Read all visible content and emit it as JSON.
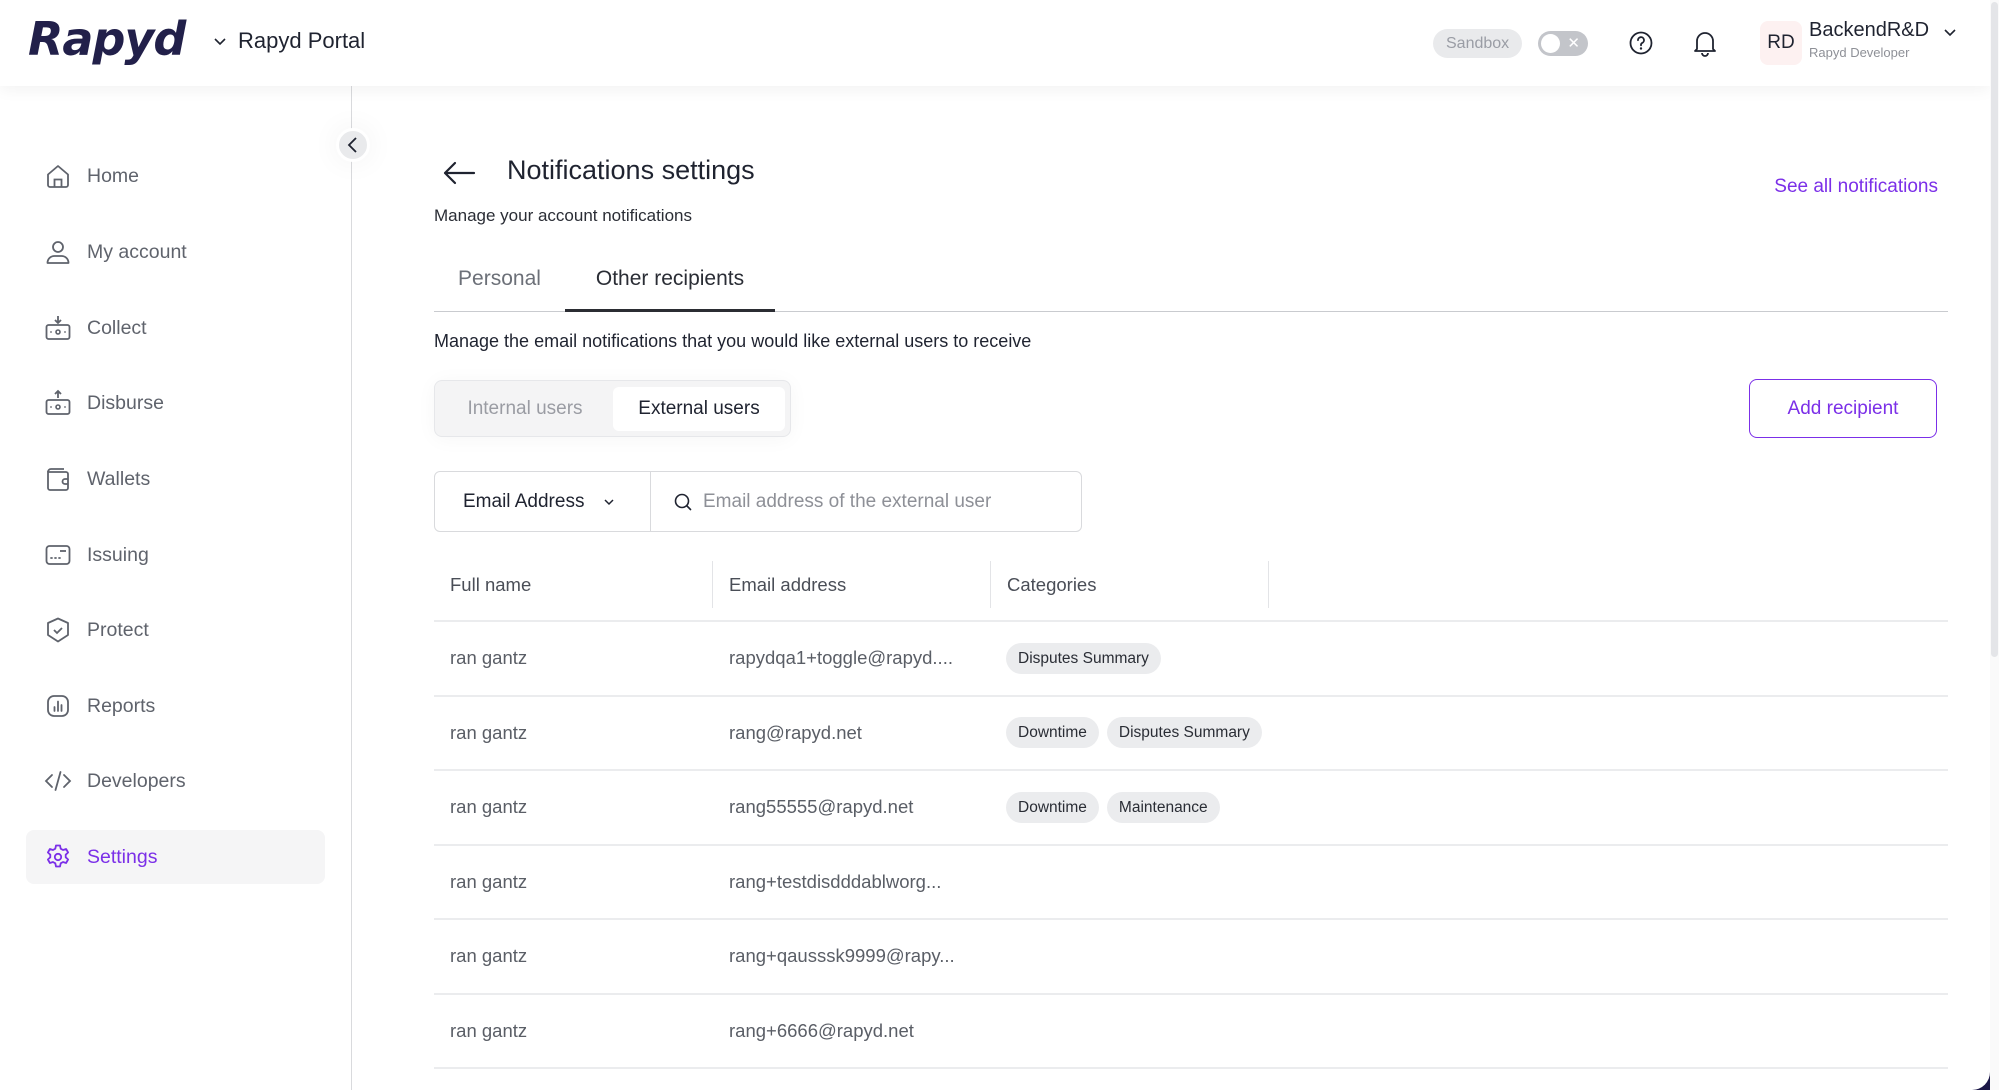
{
  "header": {
    "logo": "Rapyd",
    "portal_label": "Rapyd Portal",
    "env_badge": "Sandbox",
    "toggle_on": false,
    "user": {
      "initials": "RD",
      "name": "BackendR&D",
      "role": "Rapyd Developer"
    }
  },
  "sidebar": {
    "items": [
      {
        "label": "Home",
        "icon": "home-icon",
        "active": false
      },
      {
        "label": "My account",
        "icon": "user-icon",
        "active": false
      },
      {
        "label": "Collect",
        "icon": "collect-icon",
        "active": false
      },
      {
        "label": "Disburse",
        "icon": "disburse-icon",
        "active": false
      },
      {
        "label": "Wallets",
        "icon": "wallet-icon",
        "active": false
      },
      {
        "label": "Issuing",
        "icon": "card-icon",
        "active": false
      },
      {
        "label": "Protect",
        "icon": "shield-check-icon",
        "active": false
      },
      {
        "label": "Reports",
        "icon": "reports-icon",
        "active": false
      },
      {
        "label": "Developers",
        "icon": "code-icon",
        "active": false
      },
      {
        "label": "Settings",
        "icon": "gear-icon",
        "active": true
      }
    ]
  },
  "page": {
    "title": "Notifications settings",
    "subtitle": "Manage your account notifications",
    "see_all_link": "See all notifications",
    "tabs": [
      {
        "label": "Personal",
        "active": false
      },
      {
        "label": "Other recipients",
        "active": true
      }
    ],
    "description": "Manage the email notifications that you would like external users to receive",
    "segments": [
      {
        "label": "Internal users",
        "active": false
      },
      {
        "label": "External users",
        "active": true
      }
    ],
    "add_button": "Add recipient",
    "search": {
      "filter_value": "Email Address",
      "placeholder": "Email address of the external user",
      "value": ""
    }
  },
  "table": {
    "columns": [
      "Full name",
      "Email address",
      "Categories"
    ],
    "rows": [
      {
        "name": "ran gantz",
        "email": "rapydqa1+toggle@rapyd....",
        "categories": [
          "Disputes Summary"
        ]
      },
      {
        "name": "ran gantz",
        "email": "rang@rapyd.net",
        "categories": [
          "Downtime",
          "Disputes Summary"
        ]
      },
      {
        "name": "ran gantz",
        "email": "rang55555@rapyd.net",
        "categories": [
          "Downtime",
          "Maintenance"
        ]
      },
      {
        "name": "ran gantz",
        "email": "rang+testdisdddablworg...",
        "categories": []
      },
      {
        "name": "ran gantz",
        "email": "rang+qausssk9999@rapy...",
        "categories": []
      },
      {
        "name": "ran gantz",
        "email": "rang+6666@rapyd.net",
        "categories": []
      }
    ]
  },
  "colors": {
    "accent": "#7b2fe8",
    "brand_navy": "#22204a"
  }
}
